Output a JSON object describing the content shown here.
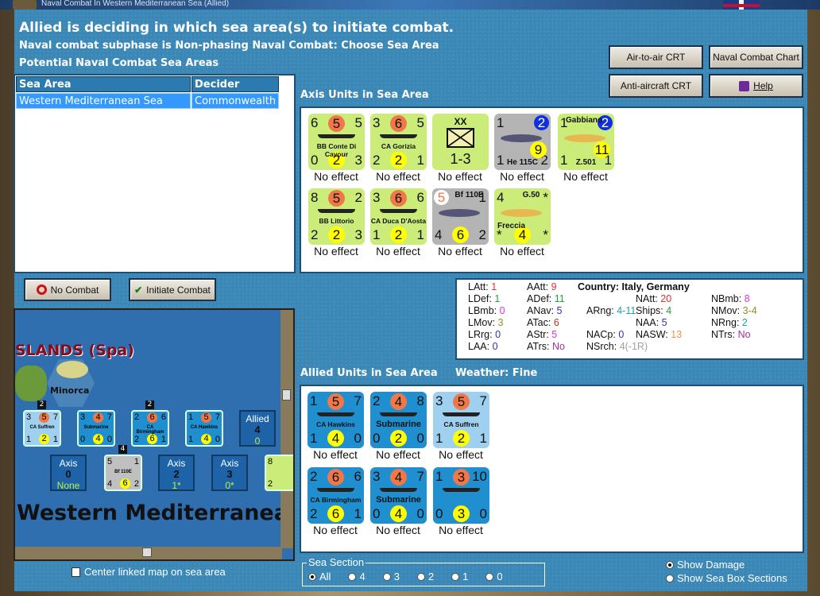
{
  "window": {
    "title": "Naval Combat In Western Mediterranean Sea (Allied)"
  },
  "header": {
    "line1": "Allied is deciding in which sea area(s) to initiate combat.",
    "line2": "Naval combat subphase is Non-phasing Naval Combat: Choose Sea Area",
    "line3": "Potential Naval Combat Sea Areas"
  },
  "table": {
    "columns": [
      "Sea Area",
      "Decider"
    ],
    "rows": [
      [
        "Western Mediterranean Sea",
        "Commonwealth"
      ]
    ]
  },
  "buttons": {
    "no_combat": "No Combat",
    "initiate": "Initiate Combat",
    "air_to_air": "Air-to-air CRT",
    "naval_chart": "Naval Combat Chart",
    "anti_aircraft": "Anti-aircraft CRT",
    "help": "Help"
  },
  "axis_title": "Axis Units in Sea Area",
  "allied_title": "Allied Units in Sea Area",
  "weather": "Weather:  Fine",
  "colors": {
    "axis_naval": "#ccec7a",
    "axis_air": "#b4b4b4",
    "allied": "#1f8fd0",
    "allied_light": "#9fd0f0",
    "orange": "#f07848",
    "yellow": "#ffff00",
    "blue": "#1030e0"
  },
  "axis_units": [
    {
      "name": "BB Conte Di Cavour",
      "tl": "6",
      "tc": "5",
      "tr": "5",
      "bl": "0",
      "bc": "2",
      "br": "3",
      "bg": "axis_naval",
      "status": "No effect"
    },
    {
      "name": "CA Gorizia",
      "tl": "3",
      "tc": "6",
      "tr": "5",
      "bl": "2",
      "bc": "2",
      "br": "1",
      "bg": "axis_naval",
      "status": "No effect"
    },
    {
      "name": "1-3",
      "division": "XX",
      "bg": "axis_naval",
      "status": "No effect"
    },
    {
      "name": "He 115C",
      "tl": "1",
      "tr": "2",
      "bl": "1",
      "br": "2",
      "extra": "9",
      "bg": "axis_air",
      "air": true,
      "status": "No effect"
    },
    {
      "name": "Z.501",
      "title": "Gabbiano",
      "tl": "1",
      "tr": "2",
      "bl": "1",
      "br": "1",
      "extra": "11",
      "bg": "axis_naval",
      "air": true,
      "status": "No effect"
    },
    {
      "name": "BB Littorio",
      "tl": "8",
      "tc": "5",
      "tr": "2",
      "bl": "2",
      "bc": "2",
      "br": "3",
      "bg": "axis_naval",
      "status": "No effect"
    },
    {
      "name": "CA Duca D'Aosta",
      "tl": "3",
      "tc": "6",
      "tr": "6",
      "bl": "1",
      "bc": "2",
      "br": "1",
      "bg": "axis_naval",
      "status": "No effect"
    },
    {
      "name": "Bf 110E",
      "tl": "5",
      "tr": "1",
      "bl": "4",
      "bc": "6",
      "br": "2",
      "bg": "axis_air",
      "air": true,
      "status": "No effect"
    },
    {
      "name": "G.50",
      "title": "Freccia",
      "tl": "4",
      "tr": "*",
      "bl": "*",
      "bc": "4",
      "br": "*",
      "bg": "axis_naval",
      "air": true,
      "status": "No effect"
    }
  ],
  "allied_units": [
    {
      "name": "CA Hawkins",
      "tl": "1",
      "tc": "5",
      "tr": "7",
      "bl": "1",
      "bc": "4",
      "br": "0",
      "bg": "allied",
      "status": "No effect"
    },
    {
      "name": "Submarine",
      "tl": "2",
      "tc": "4",
      "tr": "8",
      "bl": "0",
      "bc": "2",
      "br": "0",
      "bg": "allied",
      "status": "No effect"
    },
    {
      "name": "CA Suffren",
      "tl": "3",
      "tc": "5",
      "tr": "7",
      "bl": "1",
      "bc": "2",
      "br": "1",
      "bg": "allied_light",
      "status": "No effect"
    },
    {
      "name": "CA Birmingham",
      "tl": "2",
      "tc": "6",
      "tr": "6",
      "bl": "2",
      "bc": "6",
      "br": "1",
      "bg": "allied",
      "status": "No effect"
    },
    {
      "name": "Submarine",
      "tl": "3",
      "tc": "4",
      "tr": "7",
      "bl": "0",
      "bc": "4",
      "br": "0",
      "bg": "allied",
      "status": "No effect"
    },
    {
      "name": "",
      "tl": "1",
      "tc": "3",
      "tr": "10",
      "bl": "0",
      "bc": "3",
      "br": "0",
      "bg": "allied",
      "status": "No effect"
    }
  ],
  "stats": {
    "country": "Country: Italy, Germany",
    "items": [
      {
        "label": "LAtt:",
        "value": "1",
        "color": "#e03030"
      },
      {
        "label": "LDef:",
        "value": "1",
        "color": "#20a040"
      },
      {
        "label": "LBmb:",
        "value": "0",
        "color": "#e030e0"
      },
      {
        "label": "LMov:",
        "value": "3",
        "color": "#909020"
      },
      {
        "label": "LRrg:",
        "value": "0",
        "color": "#3030c0"
      },
      {
        "label": "LAA:",
        "value": "0",
        "color": "#3030c0"
      },
      {
        "label": "AAtt:",
        "value": "9",
        "color": "#e03030"
      },
      {
        "label": "ADef:",
        "value": "11",
        "color": "#20a040"
      },
      {
        "label": "ANav:",
        "value": "5",
        "color": "#3030c0"
      },
      {
        "label": "ATac:",
        "value": "6",
        "color": "#c03020"
      },
      {
        "label": "AStr:",
        "value": "5",
        "color": "#e030e0"
      },
      {
        "label": "ATrs:",
        "value": "No",
        "color": "#a030a0"
      },
      {
        "label": "ARng:",
        "value": "4-11",
        "color": "#20a0a0"
      },
      {
        "label": "NACp:",
        "value": "0",
        "color": "#3030c0"
      },
      {
        "label": "NSrch:",
        "value": "4(-1R)",
        "color": "#a0a0a0"
      },
      {
        "label": "NAtt:",
        "value": "20",
        "color": "#e03030"
      },
      {
        "label": "Ships:",
        "value": "4",
        "color": "#20a040"
      },
      {
        "label": "NAA:",
        "value": "5",
        "color": "#3030c0"
      },
      {
        "label": "NASW:",
        "value": "13",
        "color": "#f09040"
      },
      {
        "label": "NBmb:",
        "value": "8",
        "color": "#e030e0"
      },
      {
        "label": "NMov:",
        "value": "3-4",
        "color": "#909020"
      },
      {
        "label": "NRng:",
        "value": "2",
        "color": "#20a0a0"
      },
      {
        "label": "NTrs:",
        "value": "No",
        "color": "#a030a0"
      }
    ]
  },
  "map": {
    "region": "SLANDS (Spa)",
    "island": "Minorca",
    "sea": "Western Mediterranea",
    "counters": [
      {
        "name": "CA Suffren",
        "t": [
          "3",
          "5",
          "7"
        ],
        "b": [
          "1",
          "2",
          "1"
        ],
        "light": true,
        "stack": "2"
      },
      {
        "name": "Submarine",
        "t": [
          "3",
          "4",
          "7"
        ],
        "b": [
          "0",
          "4",
          "0"
        ]
      },
      {
        "name": "CA Birmingham",
        "t": [
          "2",
          "6",
          "6"
        ],
        "b": [
          "2",
          "6",
          "1"
        ],
        "stack": "2"
      },
      {
        "name": "CA Hawkins",
        "t": [
          "1",
          "5",
          "7"
        ],
        "b": [
          "1",
          "4",
          "0"
        ]
      }
    ],
    "allied_box": {
      "label": "Allied",
      "count": "4",
      "sub": "0"
    },
    "axis_boxes": [
      {
        "label": "Axis",
        "count": "0",
        "sub": "None"
      },
      {
        "label": "Axis",
        "count": "2",
        "sub": "1*"
      },
      {
        "label": "Axis",
        "count": "3",
        "sub": "0*"
      }
    ],
    "air_counter": {
      "name": "Bf 110E",
      "t": [
        "5",
        "",
        "1"
      ],
      "b": [
        "4",
        "6",
        "2"
      ],
      "stack": "4"
    },
    "partial_counter": {
      "t": "8",
      "b": "2"
    }
  },
  "center_map_label": "Center linked map on sea area",
  "sea_section": {
    "title": "Sea Section",
    "options": [
      "All",
      "4",
      "3",
      "2",
      "1",
      "0"
    ],
    "selected": "All"
  },
  "display": {
    "options": [
      "Show Damage",
      "Show Sea Box Sections"
    ],
    "selected": "Show Damage"
  }
}
